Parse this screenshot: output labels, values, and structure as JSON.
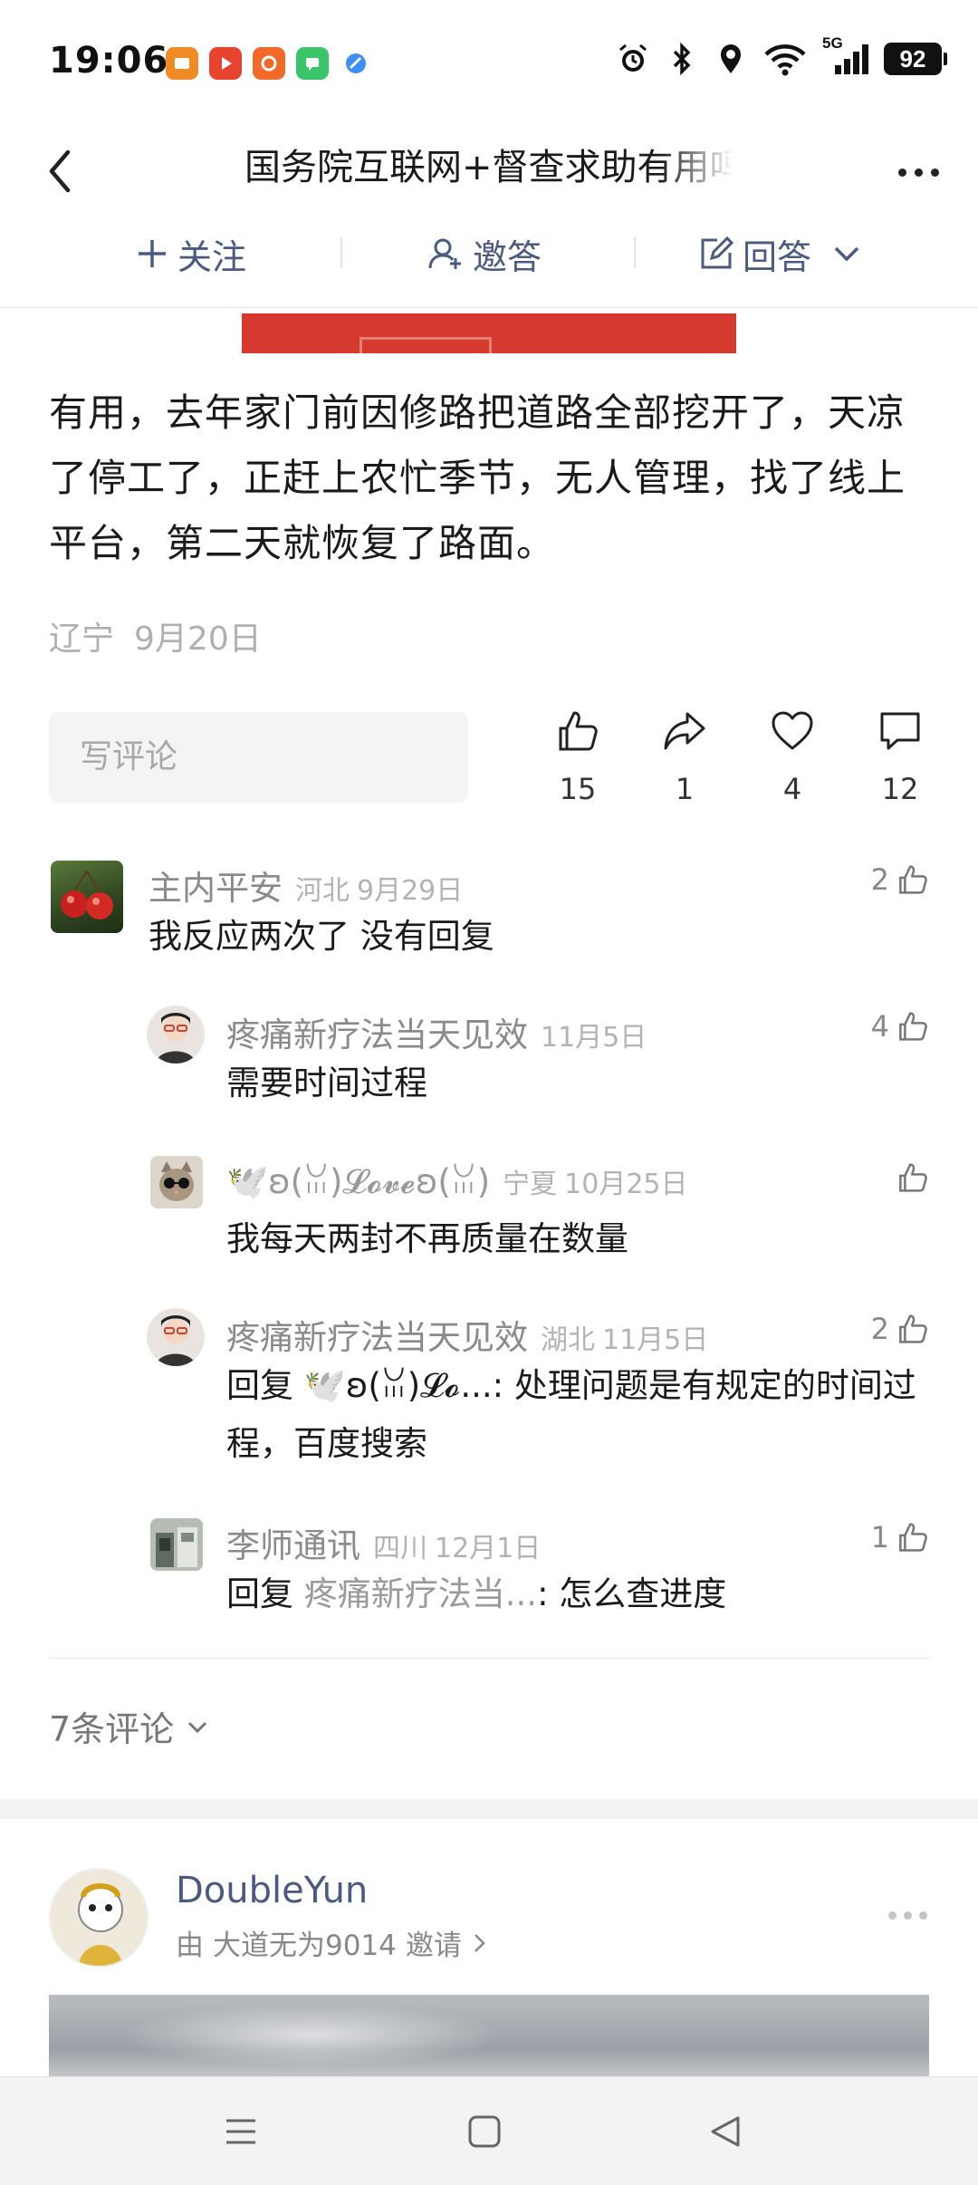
{
  "status_bar": {
    "time": "19:06",
    "battery": "92",
    "network": "5G"
  },
  "header": {
    "title": "国务院互联网+督查求助有用吗"
  },
  "actions": {
    "follow": "关注",
    "invite": "邀答",
    "answer": "回答"
  },
  "answer": {
    "text": "有用，去年家门前因修路把道路全部挖开了，天凉了停工了，正赶上农忙季节，无人管理，找了线上平台，第二天就恢复了路面。",
    "location": "辽宁",
    "date": "9月20日"
  },
  "engagement": {
    "comment_placeholder": "写评论",
    "likes": "15",
    "shares": "1",
    "favorites": "4",
    "comments": "12"
  },
  "comments": [
    {
      "name": "主内平安",
      "location": "河北",
      "date": "9月29日",
      "text": "我反应两次了 没有回复",
      "likes": "2"
    },
    {
      "name": "疼痛新疗法当天见效",
      "location": "",
      "date": "11月5日",
      "text": "需要时间过程",
      "likes": "4"
    },
    {
      "name": "🕊️ʚ(ꈍ)𝓛𝓸𝓿𝓮ʚ(ꈍ)",
      "location": "宁夏",
      "date": "10月25日",
      "text": "我每天两封不再质量在数量",
      "likes": ""
    },
    {
      "name": "疼痛新疗法当天见效",
      "location": "湖北",
      "date": "11月5日",
      "reply_prefix": "回复",
      "reply_target": "🕊️ʚ(ꈍ)𝓛𝓸...",
      "text": ": 处理问题是有规定的时间过程，百度搜索",
      "likes": "2"
    },
    {
      "name": "李师通讯",
      "location": "四川",
      "date": "12月1日",
      "reply_prefix": "回复",
      "reply_target": "疼痛新疗法当...",
      "text": ": 怎么查进度",
      "likes": "1"
    }
  ],
  "more_comments": "7条评论",
  "next_answer": {
    "author": "DoubleYun",
    "invite_prefix": "由",
    "inviter": "大道无为9014",
    "invite_suffix": "邀请"
  },
  "colors": {
    "accent": "#4a5a80",
    "banner_red": "#d63a2f",
    "muted": "#8a8a8a"
  },
  "icons": [
    "back-icon",
    "more-icon",
    "plus-icon",
    "invite-user-icon",
    "edit-icon",
    "chevron-down-icon",
    "thumbs-up-icon",
    "share-icon",
    "heart-icon",
    "comment-icon",
    "chevron-right-icon",
    "menu-icon",
    "home-icon",
    "nav-back-icon"
  ]
}
